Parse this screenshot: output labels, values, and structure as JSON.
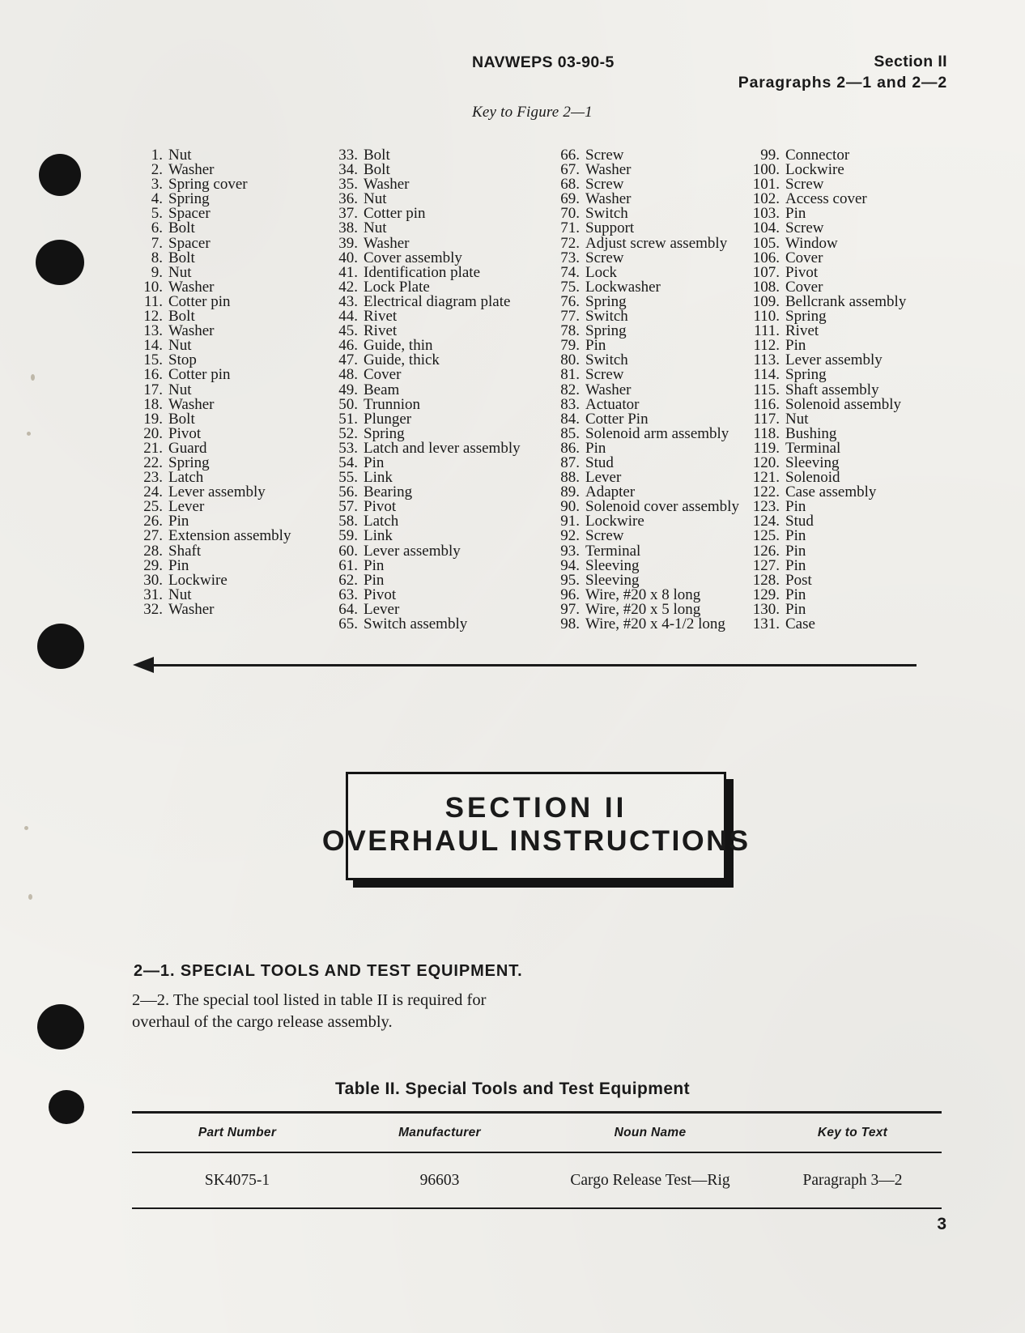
{
  "header": {
    "left": "NAVWEPS 03-90-5",
    "right_line1": "Section II",
    "right_line2": "Paragraphs 2—1 and 2—2",
    "key_caption": "Key to Figure 2—1"
  },
  "key_list": {
    "columns": [
      [
        {
          "num": "1.",
          "label": "Nut"
        },
        {
          "num": "2.",
          "label": "Washer"
        },
        {
          "num": "3.",
          "label": "Spring cover"
        },
        {
          "num": "4.",
          "label": "Spring"
        },
        {
          "num": "5.",
          "label": "Spacer"
        },
        {
          "num": "6.",
          "label": "Bolt"
        },
        {
          "num": "7.",
          "label": "Spacer"
        },
        {
          "num": "8.",
          "label": "Bolt"
        },
        {
          "num": "9.",
          "label": "Nut"
        },
        {
          "num": "10.",
          "label": "Washer"
        },
        {
          "num": "11.",
          "label": "Cotter pin"
        },
        {
          "num": "12.",
          "label": "Bolt"
        },
        {
          "num": "13.",
          "label": "Washer"
        },
        {
          "num": "14.",
          "label": "Nut"
        },
        {
          "num": "15.",
          "label": "Stop"
        },
        {
          "num": "16.",
          "label": "Cotter pin"
        },
        {
          "num": "17.",
          "label": "Nut"
        },
        {
          "num": "18.",
          "label": "Washer"
        },
        {
          "num": "19.",
          "label": "Bolt"
        },
        {
          "num": "20.",
          "label": "Pivot"
        },
        {
          "num": "21.",
          "label": "Guard"
        },
        {
          "num": "22.",
          "label": "Spring"
        },
        {
          "num": "23.",
          "label": "Latch"
        },
        {
          "num": "24.",
          "label": "Lever assembly"
        },
        {
          "num": "25.",
          "label": "Lever"
        },
        {
          "num": "26.",
          "label": "Pin"
        },
        {
          "num": "27.",
          "label": "Extension assembly"
        },
        {
          "num": "28.",
          "label": "Shaft"
        },
        {
          "num": "29.",
          "label": "Pin"
        },
        {
          "num": "30.",
          "label": "Lockwire"
        },
        {
          "num": "31.",
          "label": "Nut"
        },
        {
          "num": "32.",
          "label": "Washer"
        }
      ],
      [
        {
          "num": "33.",
          "label": "Bolt"
        },
        {
          "num": "34.",
          "label": "Bolt"
        },
        {
          "num": "35.",
          "label": "Washer"
        },
        {
          "num": "36.",
          "label": "Nut"
        },
        {
          "num": "37.",
          "label": "Cotter pin"
        },
        {
          "num": "38.",
          "label": "Nut"
        },
        {
          "num": "39.",
          "label": "Washer"
        },
        {
          "num": "40.",
          "label": "Cover assembly"
        },
        {
          "num": "41.",
          "label": "Identification plate"
        },
        {
          "num": "42.",
          "label": "Lock Plate"
        },
        {
          "num": "43.",
          "label": "Electrical diagram plate"
        },
        {
          "num": "44.",
          "label": "Rivet"
        },
        {
          "num": "45.",
          "label": "Rivet"
        },
        {
          "num": "46.",
          "label": "Guide, thin"
        },
        {
          "num": "47.",
          "label": "Guide, thick"
        },
        {
          "num": "48.",
          "label": "Cover"
        },
        {
          "num": "49.",
          "label": "Beam"
        },
        {
          "num": "50.",
          "label": "Trunnion"
        },
        {
          "num": "51.",
          "label": "Plunger"
        },
        {
          "num": "52.",
          "label": "Spring"
        },
        {
          "num": "53.",
          "label": "Latch and lever assembly"
        },
        {
          "num": "54.",
          "label": "Pin"
        },
        {
          "num": "55.",
          "label": "Link"
        },
        {
          "num": "56.",
          "label": "Bearing"
        },
        {
          "num": "57.",
          "label": "Pivot"
        },
        {
          "num": "58.",
          "label": "Latch"
        },
        {
          "num": "59.",
          "label": "Link"
        },
        {
          "num": "60.",
          "label": "Lever assembly"
        },
        {
          "num": "61.",
          "label": "Pin"
        },
        {
          "num": "62.",
          "label": "Pin"
        },
        {
          "num": "63.",
          "label": "Pivot"
        },
        {
          "num": "64.",
          "label": "Lever"
        },
        {
          "num": "65.",
          "label": "Switch assembly"
        }
      ],
      [
        {
          "num": "66.",
          "label": "Screw"
        },
        {
          "num": "67.",
          "label": "Washer"
        },
        {
          "num": "68.",
          "label": "Screw"
        },
        {
          "num": "69.",
          "label": "Washer"
        },
        {
          "num": "70.",
          "label": "Switch"
        },
        {
          "num": "71.",
          "label": "Support"
        },
        {
          "num": "72.",
          "label": "Adjust screw assembly"
        },
        {
          "num": "73.",
          "label": "Screw"
        },
        {
          "num": "74.",
          "label": "Lock"
        },
        {
          "num": "75.",
          "label": "Lockwasher"
        },
        {
          "num": "76.",
          "label": "Spring"
        },
        {
          "num": "77.",
          "label": "Switch"
        },
        {
          "num": "78.",
          "label": "Spring"
        },
        {
          "num": "79.",
          "label": "Pin"
        },
        {
          "num": "80.",
          "label": "Switch"
        },
        {
          "num": "81.",
          "label": "Screw"
        },
        {
          "num": "82.",
          "label": "Washer"
        },
        {
          "num": "83.",
          "label": "Actuator"
        },
        {
          "num": "84.",
          "label": "Cotter Pin"
        },
        {
          "num": "85.",
          "label": "Solenoid arm assembly"
        },
        {
          "num": "86.",
          "label": "Pin"
        },
        {
          "num": "87.",
          "label": "Stud"
        },
        {
          "num": "88.",
          "label": "Lever"
        },
        {
          "num": "89.",
          "label": "Adapter"
        },
        {
          "num": "90.",
          "label": "Solenoid cover assembly"
        },
        {
          "num": "91.",
          "label": "Lockwire"
        },
        {
          "num": "92.",
          "label": "Screw"
        },
        {
          "num": "93.",
          "label": "Terminal"
        },
        {
          "num": "94.",
          "label": "Sleeving"
        },
        {
          "num": "95.",
          "label": "Sleeving"
        },
        {
          "num": "96.",
          "label": "Wire, #20 x 8 long"
        },
        {
          "num": "97.",
          "label": "Wire, #20 x 5 long"
        },
        {
          "num": "98.",
          "label": "Wire, #20 x 4-1/2 long"
        }
      ],
      [
        {
          "num": "99.",
          "label": "Connector"
        },
        {
          "num": "100.",
          "label": "Lockwire"
        },
        {
          "num": "101.",
          "label": "Screw"
        },
        {
          "num": "102.",
          "label": "Access cover"
        },
        {
          "num": "103.",
          "label": "Pin"
        },
        {
          "num": "104.",
          "label": "Screw"
        },
        {
          "num": "105.",
          "label": "Window"
        },
        {
          "num": "106.",
          "label": "Cover"
        },
        {
          "num": "107.",
          "label": "Pivot"
        },
        {
          "num": "108.",
          "label": "Cover"
        },
        {
          "num": "109.",
          "label": "Bellcrank assembly"
        },
        {
          "num": "110.",
          "label": "Spring"
        },
        {
          "num": "111.",
          "label": "Rivet"
        },
        {
          "num": "112.",
          "label": "Pin"
        },
        {
          "num": "113.",
          "label": "Lever assembly"
        },
        {
          "num": "114.",
          "label": "Spring"
        },
        {
          "num": "115.",
          "label": "Shaft assembly"
        },
        {
          "num": "116.",
          "label": "Solenoid assembly"
        },
        {
          "num": "117.",
          "label": "Nut"
        },
        {
          "num": "118.",
          "label": "Bushing"
        },
        {
          "num": "119.",
          "label": "Terminal"
        },
        {
          "num": "120.",
          "label": "Sleeving"
        },
        {
          "num": "121.",
          "label": "Solenoid"
        },
        {
          "num": "122.",
          "label": "Case assembly"
        },
        {
          "num": "123.",
          "label": "Pin"
        },
        {
          "num": "124.",
          "label": "Stud"
        },
        {
          "num": "125.",
          "label": "Pin"
        },
        {
          "num": "126.",
          "label": "Pin"
        },
        {
          "num": "127.",
          "label": "Pin"
        },
        {
          "num": "128.",
          "label": "Post"
        },
        {
          "num": "129.",
          "label": "Pin"
        },
        {
          "num": "130.",
          "label": "Pin"
        },
        {
          "num": "131.",
          "label": "Case"
        }
      ]
    ]
  },
  "banner": {
    "line1": "SECTION II",
    "line2": "OVERHAUL INSTRUCTIONS"
  },
  "body": {
    "paragraph_heading": "2—1. SPECIAL TOOLS AND TEST EQUIPMENT.",
    "paragraph_text": "2—2. The special tool listed in table II is required for overhaul of the cargo release assembly."
  },
  "table": {
    "title": "Table II.  Special Tools and Test Equipment",
    "headers": [
      "Part Number",
      "Manufacturer",
      "Noun Name",
      "Key to Text"
    ],
    "rows": [
      {
        "part_number": "SK4075-1",
        "manufacturer": "96603",
        "noun_name": "Cargo Release Test—Rig",
        "key_to_text": "Paragraph 3—2"
      }
    ]
  },
  "footer": {
    "page_number": "3"
  }
}
